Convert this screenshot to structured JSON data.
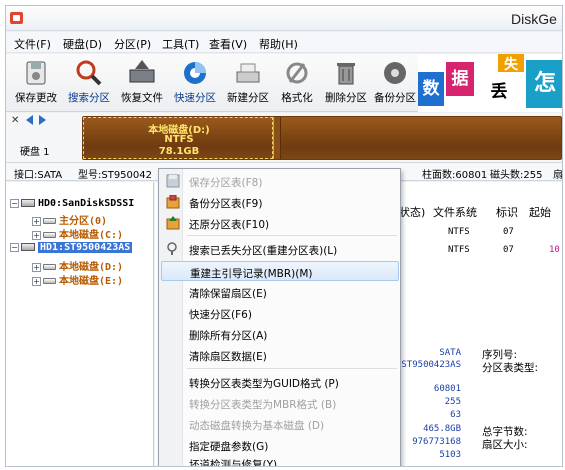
{
  "window": {
    "title": "DiskGe"
  },
  "menu": [
    {
      "label": "文件(F)"
    },
    {
      "label": "硬盘(D)"
    },
    {
      "label": "分区(P)"
    },
    {
      "label": "工具(T)"
    },
    {
      "label": "查看(V)"
    },
    {
      "label": "帮助(H)"
    }
  ],
  "toolbar": [
    {
      "label": "保存更改",
      "icon": "save-changes-icon"
    },
    {
      "label": "搜索分区",
      "icon": "search-partition-icon"
    },
    {
      "label": "恢复文件",
      "icon": "recover-files-icon"
    },
    {
      "label": "快速分区",
      "icon": "quick-partition-icon"
    },
    {
      "label": "新建分区",
      "icon": "new-partition-icon"
    },
    {
      "label": "格式化",
      "icon": "format-icon"
    },
    {
      "label": "删除分区",
      "icon": "delete-partition-icon"
    },
    {
      "label": "备份分区",
      "icon": "backup-partition-icon"
    }
  ],
  "banner": {
    "tiles": [
      "数",
      "据",
      "失",
      "丢",
      "怎"
    ]
  },
  "disk_bar": {
    "disk_label": "硬盘 1",
    "partition_name": "本地磁盘(D:)",
    "partition_fs": "NTFS",
    "partition_size": "78.1GB"
  },
  "info_bar": {
    "interface": "接口:SATA",
    "model": "型号:ST950042",
    "cylinders": "柱面数:60801",
    "heads": "磁头数:255",
    "sectors_partial": "扇"
  },
  "tree": {
    "disk0": "HD0:SanDiskSDSSI",
    "disk0_p1": "主分区(0)",
    "disk0_p2": "本地磁盘(C:)",
    "disk1": "HD1:ST9500423AS",
    "disk1_p1": "本地磁盘(D:)",
    "disk1_p2": "本地磁盘(E:)"
  },
  "table": {
    "headers": [
      "状态)",
      "文件系统",
      "标识",
      "起始"
    ],
    "rows": [
      {
        "fs": "NTFS",
        "id": "07",
        "start": ""
      },
      {
        "fs": "NTFS",
        "id": "07",
        "start": "10"
      }
    ]
  },
  "details": {
    "interface_value": "SATA",
    "model_value": "ST9500423AS",
    "serial_label": "序列号:",
    "table_type_label": "分区表类型:",
    "cylinders_value": "60801",
    "heads_value": "255",
    "sectors_value": "63",
    "capacity_value": "465.8GB",
    "total_sectors_value": "976773168",
    "misc_value": "5103",
    "total_bytes_label": "总字节数:",
    "sector_size_label": "扇区大小:"
  },
  "context_menu": {
    "items": [
      {
        "label": "保存分区表(F8)",
        "disabled": true,
        "icon": "save-table-icon"
      },
      {
        "label": "备份分区表(F9)",
        "disabled": false,
        "icon": "backup-table-icon"
      },
      {
        "label": "还原分区表(F10)",
        "disabled": false,
        "icon": "restore-table-icon"
      },
      {
        "label": "搜索已丢失分区(重建分区表)(L)",
        "disabled": false,
        "icon": "search-lost-icon"
      },
      {
        "label": "重建主引导记录(MBR)(M)",
        "disabled": false,
        "highlighted": true
      },
      {
        "label": "清除保留扇区(E)",
        "disabled": false
      },
      {
        "label": "快速分区(F6)",
        "disabled": false
      },
      {
        "label": "删除所有分区(A)",
        "disabled": false
      },
      {
        "label": "清除扇区数据(E)",
        "disabled": false
      },
      {
        "label": "转换分区表类型为GUID格式 (P)",
        "disabled": false
      },
      {
        "label": "转换分区表类型为MBR格式 (B)",
        "disabled": true
      },
      {
        "label": "动态磁盘转换为基本磁盘 (D)",
        "disabled": true
      },
      {
        "label": "指定硬盘参数(G)",
        "disabled": false
      },
      {
        "label": "坏道检测与修复(Y)",
        "disabled": false
      }
    ]
  }
}
